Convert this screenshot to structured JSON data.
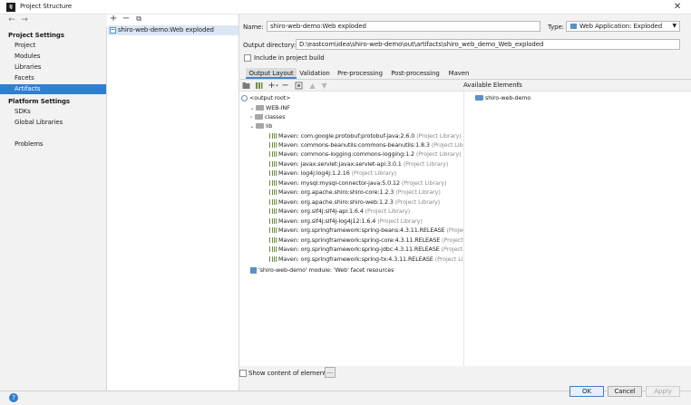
{
  "window": {
    "title": "Project Structure",
    "app_icon": "IJ"
  },
  "nav": {
    "back_icon": "arrow-left-icon",
    "forward_icon": "arrow-right-icon"
  },
  "sidebar": {
    "project_settings_header": "Project Settings",
    "project_settings_items": [
      "Project",
      "Modules",
      "Libraries",
      "Facets",
      "Artifacts"
    ],
    "selected_item": "Artifacts",
    "platform_settings_header": "Platform Settings",
    "platform_settings_items": [
      "SDKs",
      "Global Libraries"
    ],
    "problems_label": "Problems"
  },
  "middle": {
    "toolbar": [
      "+",
      "−",
      "⧉"
    ],
    "artifact_name": "shiro-web-demo:Web exploded"
  },
  "artifact": {
    "name_label": "Name:",
    "name_value": "shiro-web-demo:Web exploded",
    "type_label": "Type:",
    "type_value": "Web Application: Exploded",
    "output_dir_label": "Output directory:",
    "output_dir_value": "D:\\eastcom\\idea\\shiro-web-demo\\out\\artifacts\\shiro_web_demo_Web_exploded",
    "include_label": "Include in project build",
    "include_underline_char": "b",
    "include_checked": false
  },
  "tabs": [
    "Output Layout",
    "Validation",
    "Pre-processing",
    "Post-processing",
    "Maven"
  ],
  "active_tab": "Output Layout",
  "available_elements_label": "Available Elements",
  "available_elements": [
    "shiro-web-demo"
  ],
  "tree": {
    "root": "<output root>",
    "web_inf": "WEB-INF",
    "classes": "classes",
    "lib": "lib",
    "libraries": [
      {
        "name": "Maven: com.google.protobuf:protobuf-java:2.6.0",
        "note": "(Project Library)"
      },
      {
        "name": "Maven: commons-beanutils:commons-beanutils:1.8.3",
        "note": "(Project Library)"
      },
      {
        "name": "Maven: commons-logging:commons-logging:1.2",
        "note": "(Project Library)"
      },
      {
        "name": "Maven: javax.servlet:javax.servlet-api:3.0.1",
        "note": "(Project Library)"
      },
      {
        "name": "Maven: log4j:log4j:1.2.16",
        "note": "(Project Library)"
      },
      {
        "name": "Maven: mysql:mysql-connector-java:5.0.12",
        "note": "(Project Library)"
      },
      {
        "name": "Maven: org.apache.shiro:shiro-core:1.2.3",
        "note": "(Project Library)"
      },
      {
        "name": "Maven: org.apache.shiro:shiro-web:1.2.3",
        "note": "(Project Library)"
      },
      {
        "name": "Maven: org.slf4j:slf4j-api:1.6.4",
        "note": "(Project Library)"
      },
      {
        "name": "Maven: org.slf4j:slf4j-log4j12:1.6.4",
        "note": "(Project Library)"
      },
      {
        "name": "Maven: org.springframework:spring-beans:4.3.11.RELEASE",
        "note": "(Project Library)"
      },
      {
        "name": "Maven: org.springframework:spring-core:4.3.11.RELEASE",
        "note": "(Project Library)"
      },
      {
        "name": "Maven: org.springframework:spring-jdbc:4.3.11.RELEASE",
        "note": "(Project Library)"
      },
      {
        "name": "Maven: org.springframework:spring-tx:4.3.11.RELEASE",
        "note": "(Project Library)"
      }
    ],
    "facet_resources": "'shiro-web-demo' module: 'Web' facet resources"
  },
  "show_content_label": "Show content of elements",
  "show_content_button": "...",
  "buttons": {
    "ok": "OK",
    "cancel": "Cancel",
    "apply": "Apply"
  },
  "help_icon": "help-icon"
}
